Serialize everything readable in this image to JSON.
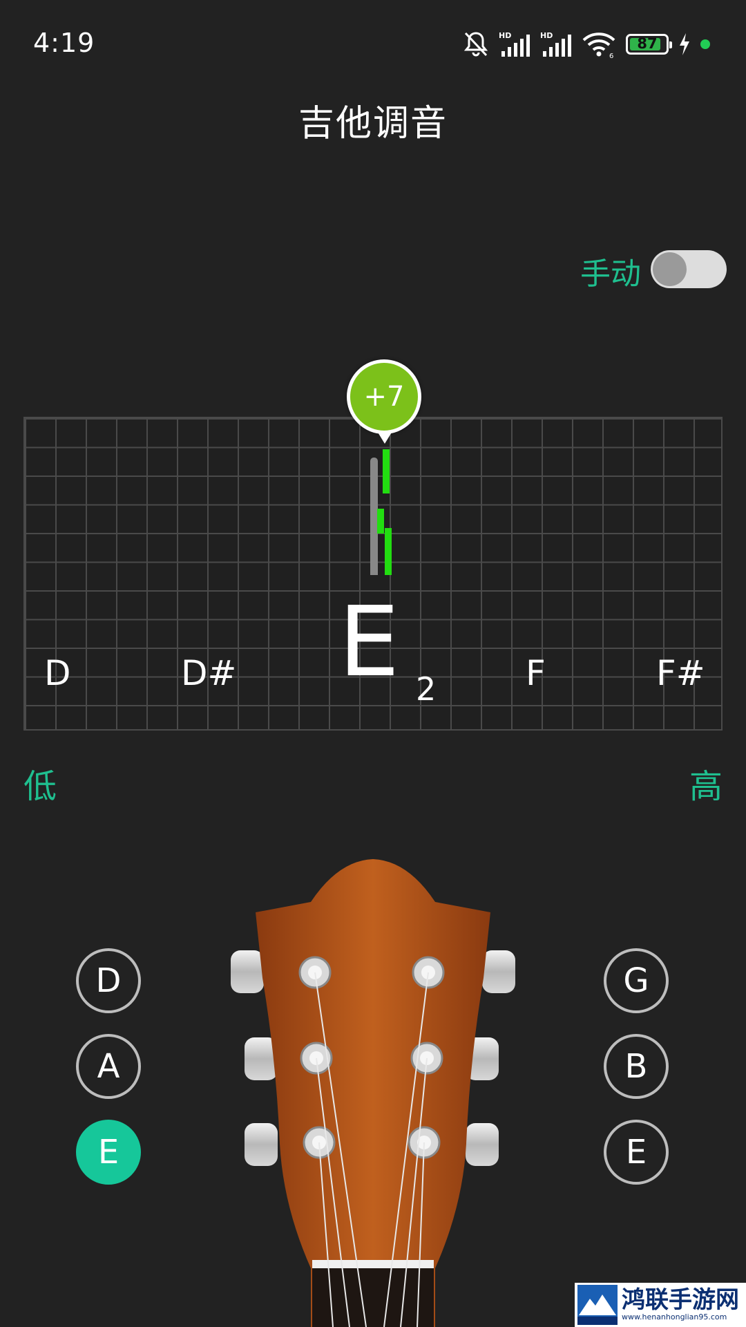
{
  "status_bar": {
    "time": "4:19",
    "battery": "87",
    "battery_percent": 87,
    "icons": [
      "bell-muted-icon",
      "hd-signal-icon",
      "hd-signal-icon",
      "wifi-icon",
      "battery-icon",
      "charging-bolt-icon",
      "green-dot-icon"
    ]
  },
  "header": {
    "title": "吉他调音"
  },
  "mode": {
    "label": "手动",
    "on": false
  },
  "tuner": {
    "cents": "+7",
    "notes": [
      "D",
      "D#",
      "F",
      "F#"
    ],
    "current_note": "E",
    "octave": "2",
    "low_label": "低",
    "high_label": "高",
    "colors": {
      "accent": "#1fbf8f",
      "bubble": "#7cc11a",
      "bars": "#22dd11"
    }
  },
  "strings": {
    "left": [
      "D",
      "A",
      "E"
    ],
    "right": [
      "G",
      "B",
      "E"
    ],
    "active": "E (left)"
  },
  "watermark": {
    "main": "鸿联手游网",
    "url": "www.henanhonglian95.com"
  }
}
